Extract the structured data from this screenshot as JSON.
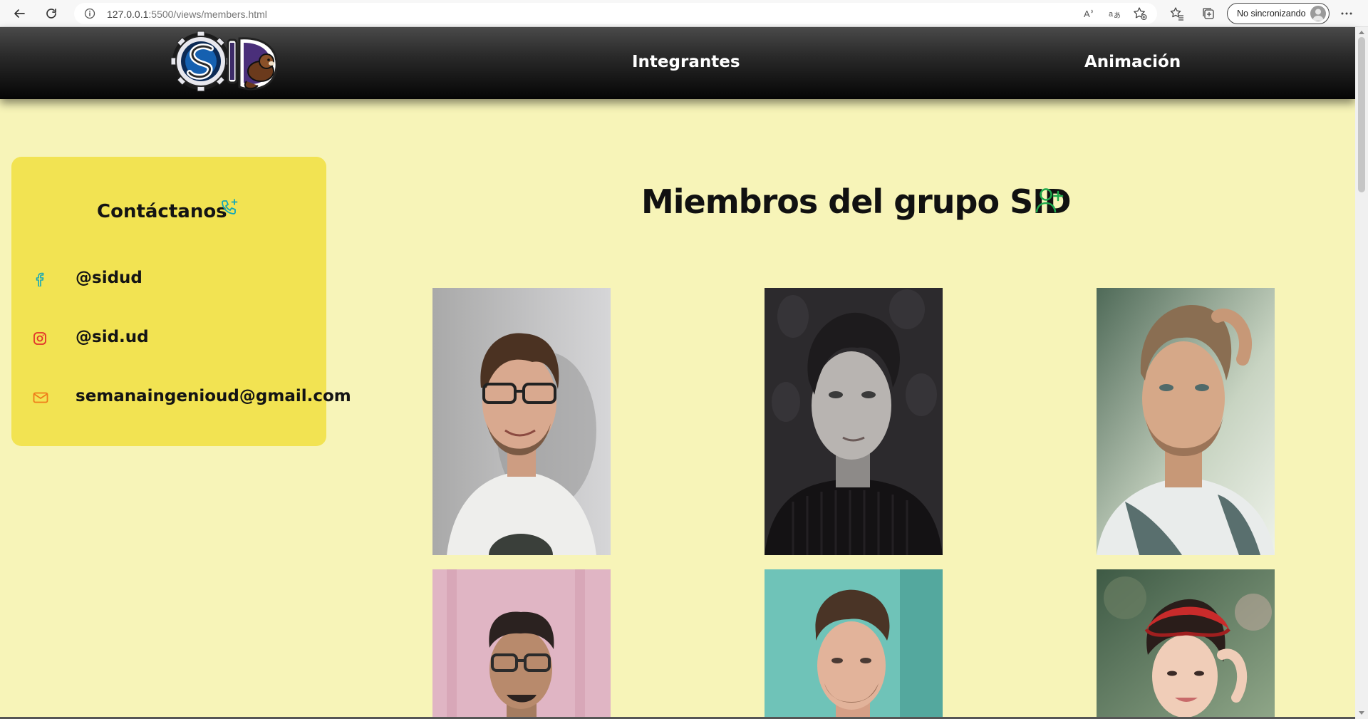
{
  "browser": {
    "url_host": "127.0.0.1",
    "url_path": ":5500/views/members.html",
    "profile_label": "No sincronizando"
  },
  "header": {
    "nav": [
      {
        "label": "Integrantes"
      },
      {
        "label": "Animación"
      }
    ]
  },
  "contact": {
    "title": "Contáctanos",
    "items": [
      {
        "icon": "facebook-icon",
        "text": "@sidud"
      },
      {
        "icon": "instagram-icon",
        "text": "@sid.ud"
      },
      {
        "icon": "mail-icon",
        "text": "semanaingenioud@gmail.com"
      }
    ]
  },
  "main": {
    "title": "Miembros del grupo SID",
    "title_icon": "user-plus-icon"
  },
  "colors": {
    "page_bg": "#f7f4b8",
    "card_bg": "#f2e352",
    "accent_green": "#1faa4c",
    "accent_cyan": "#11a7b8",
    "accent_red": "#e2332a"
  }
}
